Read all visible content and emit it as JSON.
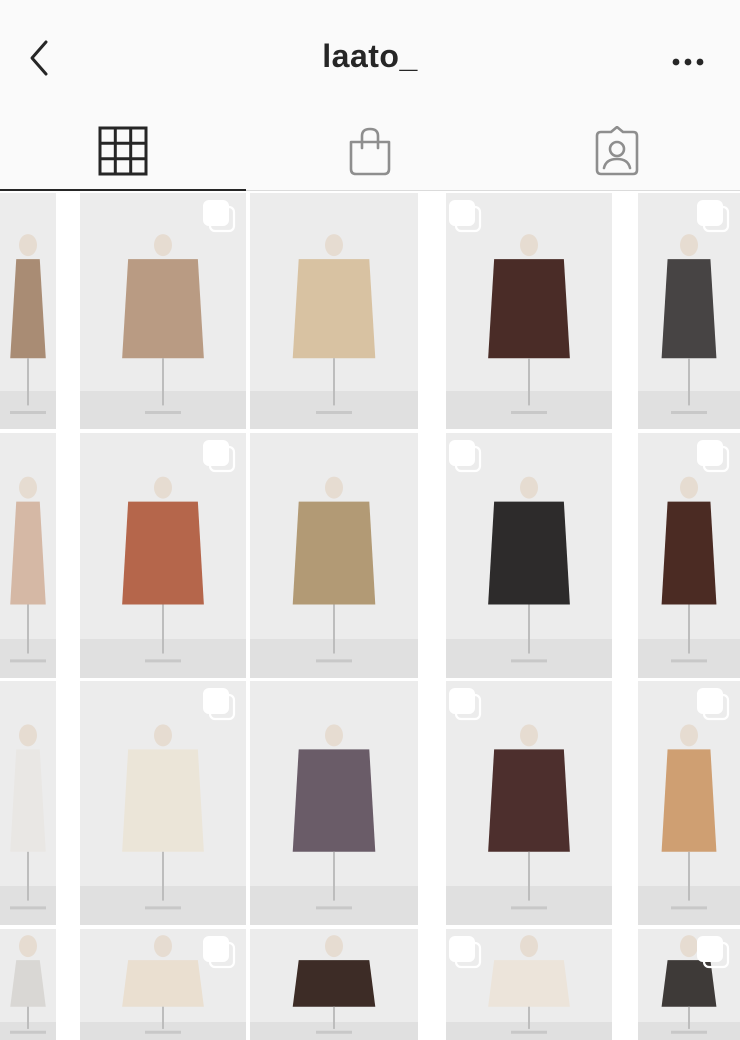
{
  "header": {
    "title": "laato_",
    "back_icon": "chevron-left-icon",
    "more_icon": "more-horizontal-icon"
  },
  "tabs": [
    {
      "name": "grid",
      "icon": "grid-icon",
      "active": true
    },
    {
      "name": "shop",
      "icon": "shopping-bag-icon",
      "active": false
    },
    {
      "name": "tagged",
      "icon": "tagged-person-icon",
      "active": false
    }
  ],
  "colors": {
    "bar_bg": "#fafafa",
    "text": "#262626",
    "divider": "#dbdbdb",
    "photo_bg": "#ececec"
  },
  "posts": [
    {
      "subject": "jacket-on-mannequin",
      "garment": "#a98c74",
      "multi": false
    },
    {
      "subject": "double-breasted-jacket-on-mannequin",
      "garment": "#b99b83",
      "multi": true
    },
    {
      "subject": "beige-cardigan-on-mannequin",
      "garment": "#d8c2a2",
      "multi": false
    },
    {
      "subject": "model-brown-knit-and-grey-skirt",
      "garment": "#4a2c27",
      "multi": true
    },
    {
      "subject": "grey-ribbed-pants-on-mannequin",
      "garment": "#474444",
      "multi": true
    },
    {
      "subject": "partial-beige-garment",
      "garment": "#d5b8a5",
      "multi": false
    },
    {
      "subject": "model-rust-jacket-beige-skirt",
      "garment": "#b5664b",
      "multi": true
    },
    {
      "subject": "model-back-camel-knit-skirt",
      "garment": "#b29a75",
      "multi": false
    },
    {
      "subject": "black-camisole-on-mannequin",
      "garment": "#2d2b2b",
      "multi": true
    },
    {
      "subject": "model-brown-jacket-cream-pants",
      "garment": "#4b2b23",
      "multi": true
    },
    {
      "subject": "white-wall-corner",
      "garment": "#e9e7e4",
      "multi": false
    },
    {
      "subject": "cream-bustier-set-on-mannequin",
      "garment": "#ebe5d8",
      "multi": true
    },
    {
      "subject": "purple-grey-pants-on-mannequin",
      "garment": "#6a5c68",
      "multi": false
    },
    {
      "subject": "model-brown-knit-purple-pants",
      "garment": "#4d2f2d",
      "multi": true
    },
    {
      "subject": "camel-knit-on-mannequin",
      "garment": "#cf9f72",
      "multi": true
    },
    {
      "subject": "partial-grey-wall",
      "garment": "#d9d7d4",
      "multi": false
    },
    {
      "subject": "model-cream-top",
      "garment": "#eadfd0",
      "multi": true
    },
    {
      "subject": "dark-brown-blouse-on-mannequin",
      "garment": "#3d2c26",
      "multi": false
    },
    {
      "subject": "model-white-top",
      "garment": "#ece4da",
      "multi": true
    },
    {
      "subject": "partial-dark-garment",
      "garment": "#3e3a38",
      "multi": true
    }
  ]
}
